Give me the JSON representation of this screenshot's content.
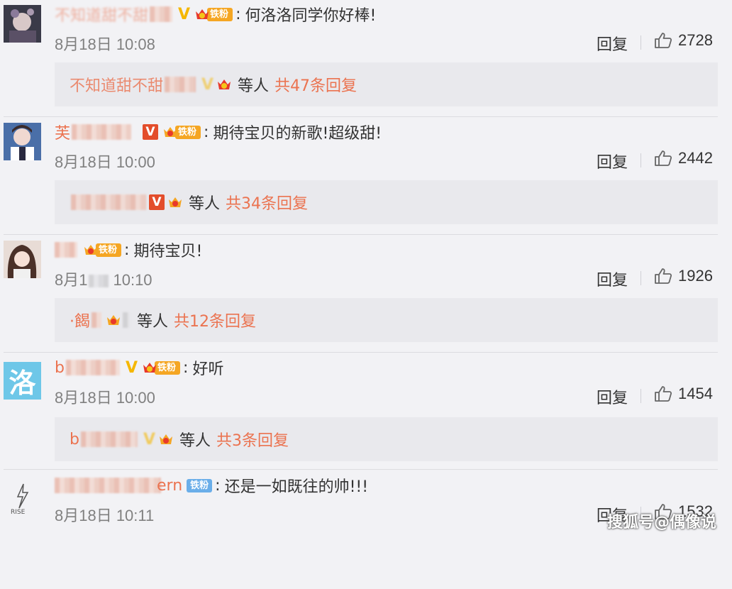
{
  "ui": {
    "reply_label": "回复",
    "etc_label": "等人"
  },
  "comments": [
    {
      "name": "不知道甜不甜",
      "vip": "yellow",
      "vip_label": "V",
      "fan_label": "铁粉",
      "fan_level": "5",
      "text": "何洛洛同学你好棒!",
      "date": "8月18日 10:08",
      "likes": "2728",
      "reply_name": "不知道甜不甜",
      "reply_count": "共47条回复",
      "avatar": "photo-dark"
    },
    {
      "name": "芙",
      "vip": "red",
      "vip_label": "V",
      "fan_label": "铁粉",
      "fan_level": "5",
      "text": "期待宝贝的新歌!超级甜!",
      "date": "8月18日 10:00",
      "likes": "2442",
      "reply_name": "",
      "reply_count": "共34条回复",
      "avatar": "photo-blue"
    },
    {
      "name": "",
      "vip": "",
      "vip_label": "",
      "fan_label": "铁粉",
      "fan_level": "4",
      "text": "期待宝贝!",
      "date": "8月1",
      "date_tail": "10:10",
      "likes": "1926",
      "reply_name": "·餲",
      "reply_count": "共12条回复",
      "avatar": "photo-girl"
    },
    {
      "name": "b",
      "vip": "yellow",
      "vip_label": "V",
      "fan_label": "铁粉",
      "fan_level": "4",
      "text": "好听",
      "date": "8月18日 10:00",
      "likes": "1454",
      "reply_name": "b",
      "reply_count": "共3条回复",
      "avatar": "text",
      "avatar_text": "洛"
    },
    {
      "name": "ern",
      "vip": "",
      "vip_label": "",
      "fan_label": "铁粉",
      "fan_level": "",
      "text": "还是一如既往的帅!!!",
      "date": "8月18日 10:11",
      "likes": "1532",
      "reply_name": "",
      "reply_count": "",
      "avatar": "logo"
    }
  ],
  "watermark": "搜狐号@偶像说"
}
